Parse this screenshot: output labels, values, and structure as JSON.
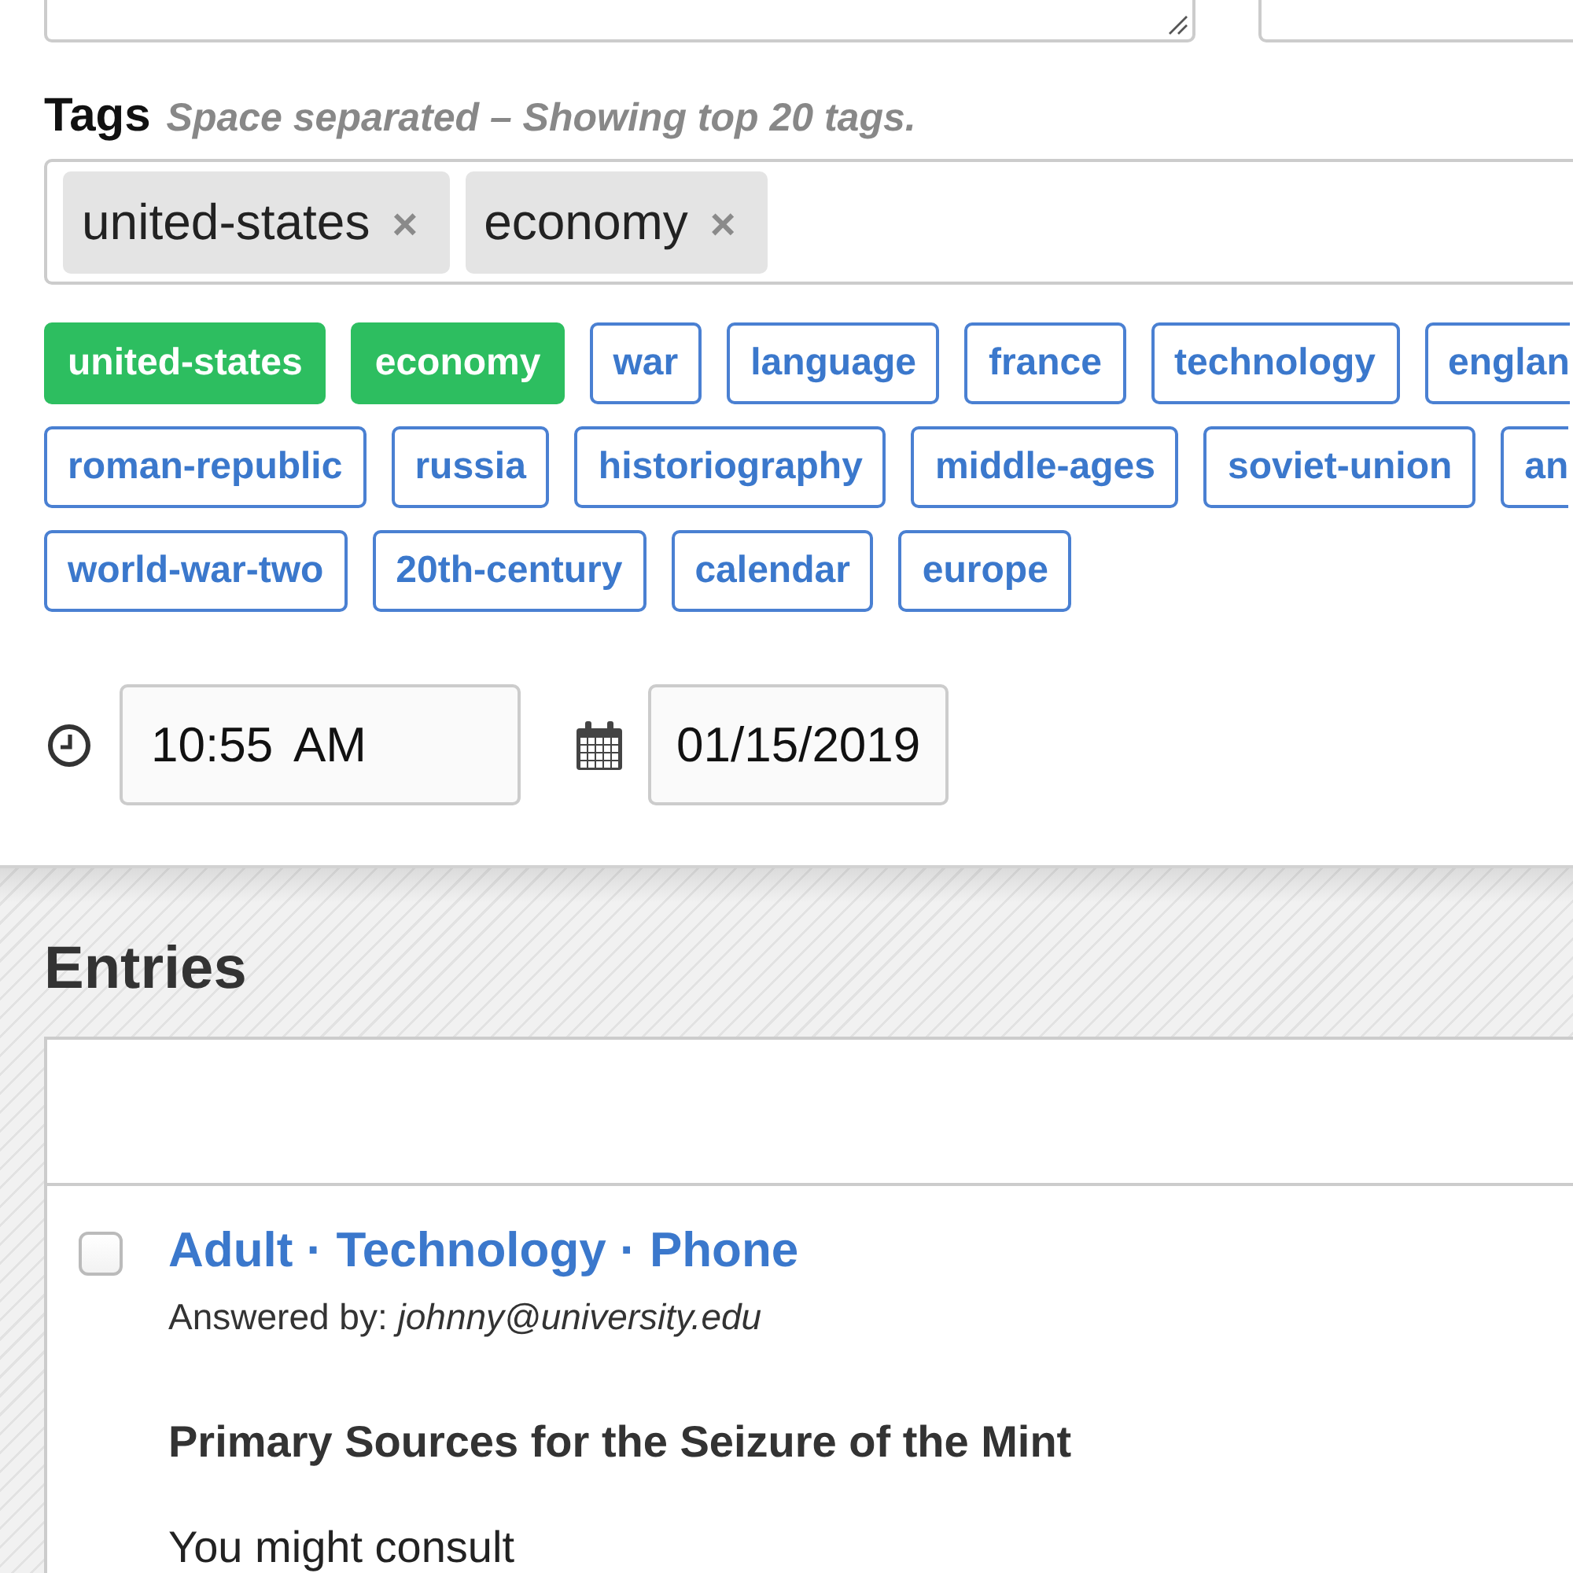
{
  "top_fields": [
    {
      "kind": "textarea"
    },
    {
      "kind": "text"
    }
  ],
  "tags": {
    "label": "Tags",
    "hint": "Space separated – Showing top 20 tags.",
    "chosen": [
      {
        "label": "united-states",
        "remove": "×"
      },
      {
        "label": "economy",
        "remove": "×"
      }
    ],
    "suggestion_rows": [
      [
        {
          "label": "united-states",
          "selected": true
        },
        {
          "label": "economy",
          "selected": true
        },
        {
          "label": "war",
          "selected": false
        },
        {
          "label": "language",
          "selected": false
        },
        {
          "label": "france",
          "selected": false
        },
        {
          "label": "technology",
          "selected": false
        },
        {
          "label": "englan",
          "selected": false
        }
      ],
      [
        {
          "label": "roman-republic",
          "selected": false
        },
        {
          "label": "russia",
          "selected": false
        },
        {
          "label": "historiography",
          "selected": false
        },
        {
          "label": "middle-ages",
          "selected": false
        },
        {
          "label": "soviet-union",
          "selected": false
        },
        {
          "label": "an",
          "selected": false
        }
      ],
      [
        {
          "label": "world-war-two",
          "selected": false
        },
        {
          "label": "20th-century",
          "selected": false
        },
        {
          "label": "calendar",
          "selected": false
        },
        {
          "label": "europe",
          "selected": false
        }
      ]
    ]
  },
  "schedule": {
    "time": "10:55 AM",
    "date": "01/15/2019"
  },
  "entries": {
    "title": "Entries",
    "items": [
      {
        "checked": false,
        "title": "Adult · Technology · Phone",
        "answered_by": "Answered by: *johnny@university.edu*",
        "heading": "Primary Sources for the Seizure of the Mint",
        "body": "You might consult"
      }
    ]
  }
}
